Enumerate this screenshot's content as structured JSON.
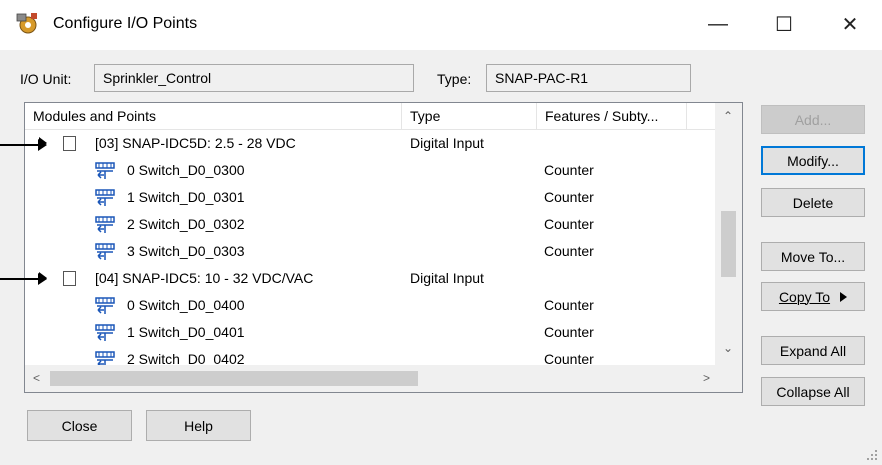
{
  "window": {
    "title": "Configure I/O Points"
  },
  "titlebar_buttons": {
    "minimize": "—",
    "maximize": "☐",
    "close": "✕"
  },
  "io_unit": {
    "label": "I/O Unit:",
    "value": "Sprinkler_Control"
  },
  "type_field": {
    "label": "Type:",
    "value": "SNAP-PAC-R1"
  },
  "columns": [
    "Modules and Points",
    "Type",
    "Features / Subty..."
  ],
  "rows": [
    {
      "kind": "module",
      "name": "[03] SNAP-IDC5D: 2.5 - 28 VDC",
      "type": "Digital Input",
      "feature": ""
    },
    {
      "kind": "point",
      "name": "0  Switch_D0_0300",
      "type": "",
      "feature": "Counter"
    },
    {
      "kind": "point",
      "name": "1  Switch_D0_0301",
      "type": "",
      "feature": "Counter"
    },
    {
      "kind": "point",
      "name": "2  Switch_D0_0302",
      "type": "",
      "feature": "Counter"
    },
    {
      "kind": "point",
      "name": "3  Switch_D0_0303",
      "type": "",
      "feature": "Counter"
    },
    {
      "kind": "module",
      "name": "[04] SNAP-IDC5: 10 - 32 VDC/VAC",
      "type": "Digital Input",
      "feature": ""
    },
    {
      "kind": "point",
      "name": "0  Switch_D0_0400",
      "type": "",
      "feature": "Counter"
    },
    {
      "kind": "point",
      "name": "1  Switch_D0_0401",
      "type": "",
      "feature": "Counter"
    },
    {
      "kind": "point",
      "name": "2  Switch_D0_0402",
      "type": "",
      "feature": "Counter"
    }
  ],
  "side_buttons": {
    "add": "Add...",
    "modify": "Modify...",
    "delete": "Delete",
    "move_to": "Move To...",
    "copy_to": "Copy To",
    "expand_all": "Expand All",
    "collapse_all": "Collapse All"
  },
  "bottom_buttons": {
    "close": "Close",
    "help": "Help"
  },
  "icons": {
    "app": "gear-icon",
    "module": "module-icon",
    "point": "digital-input-point-icon",
    "expand": "expand-arrow-icon",
    "copy_submenu": "submenu-arrow-icon",
    "scroll_up": "scroll-up-icon",
    "scroll_down": "scroll-down-icon",
    "scroll_left": "scroll-left-icon",
    "scroll_right": "scroll-right-icon"
  },
  "colors": {
    "accent": "#0078d7",
    "window_bg": "#f0f0f0",
    "point_icon": "#1a56b8"
  }
}
